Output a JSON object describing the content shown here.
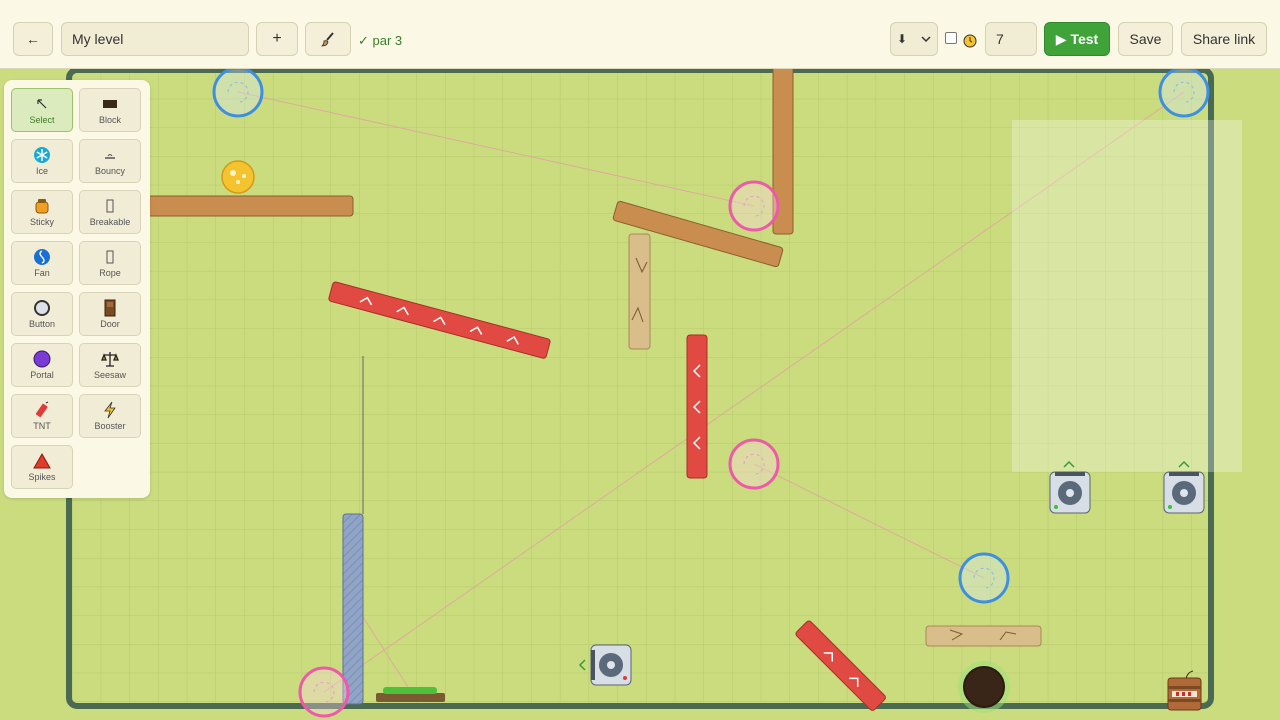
{
  "toolbar": {
    "back_label": "←",
    "level_name": "My level",
    "add_label": "+",
    "brush_icon": "brush-icon",
    "par_text": "✓ par 3",
    "select_value": "⬇",
    "timer_value": "7",
    "test_label": "▶ Test",
    "save_label": "Save",
    "share_label": "Share link"
  },
  "palette": {
    "tools": [
      {
        "label": "Select",
        "icon": "cursor-icon",
        "selected": true
      },
      {
        "label": "Block",
        "icon": "block-icon"
      },
      {
        "label": "Ice",
        "icon": "snowflake-icon"
      },
      {
        "label": "Bouncy",
        "icon": "bouncy-icon"
      },
      {
        "label": "Sticky",
        "icon": "honey-icon"
      },
      {
        "label": "Breakable",
        "icon": "breakable-icon"
      },
      {
        "label": "Fan",
        "icon": "fan-icon"
      },
      {
        "label": "Rope",
        "icon": "rope-icon"
      },
      {
        "label": "Button",
        "icon": "button-icon"
      },
      {
        "label": "Door",
        "icon": "door-icon"
      },
      {
        "label": "Portal",
        "icon": "portal-icon"
      },
      {
        "label": "Seesaw",
        "icon": "seesaw-icon"
      },
      {
        "label": "TNT",
        "icon": "tnt-icon"
      },
      {
        "label": "Booster",
        "icon": "lightning-icon"
      },
      {
        "label": "Spikes",
        "icon": "spikes-icon"
      }
    ]
  },
  "colors": {
    "grass": "#cbdc7f",
    "wall": "#4a6b52",
    "wood": "#c98e4f",
    "bouncy": "#e04a42",
    "portal_blue": "#3f8fe0",
    "portal_pink": "#ec5aa8",
    "accent_green": "#3fa33a"
  }
}
